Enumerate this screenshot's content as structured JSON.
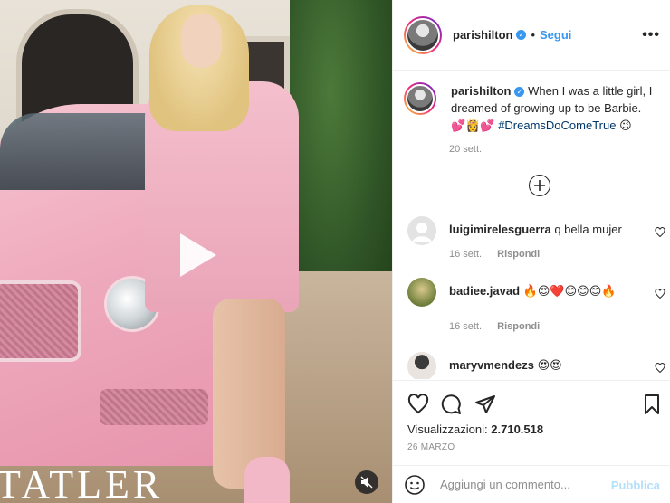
{
  "post": {
    "username": "parishilton",
    "follow_label": "Segui",
    "separator": "•",
    "more_label": "•••",
    "caption_text": "When I was a little girl, I dreamed of growing up to be Barbie.",
    "caption_emojis": "💕👸💕",
    "caption_hashtag": "#DreamsDoComeTrue",
    "caption_tail": "😉",
    "caption_age": "20 sett."
  },
  "media": {
    "brand_text": "TATLER",
    "type": "video"
  },
  "comments": [
    {
      "username": "luigimirelesguerra",
      "text": "q bella mujer",
      "age": "16 sett.",
      "reply": "Rispondi"
    },
    {
      "username": "badiee.javad",
      "text": "🔥😍❤️😊😊😊🔥",
      "age": "16 sett.",
      "reply": "Rispondi"
    },
    {
      "username": "maryvmendezs",
      "text": "😍😍",
      "age": "",
      "reply": ""
    }
  ],
  "actions": {
    "views_label": "Visualizzazioni:",
    "views_count": "2.710.518",
    "date": "26 MARZO"
  },
  "add_comment": {
    "placeholder": "Aggiungi un commento...",
    "publish_label": "Pubblica"
  },
  "colors": {
    "accent": "#3897f0",
    "publish_disabled": "#b2dffc",
    "hashtag": "#00376b",
    "muted": "#8e8e8e"
  }
}
